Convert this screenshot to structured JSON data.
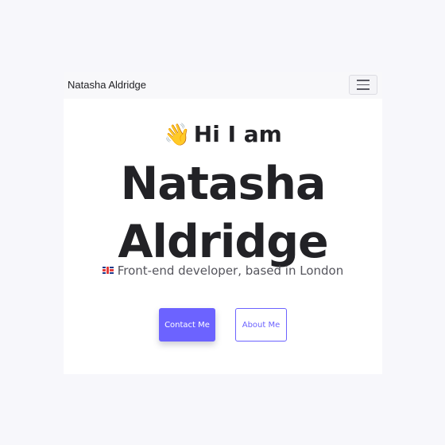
{
  "navbar": {
    "brand": "Natasha Aldridge",
    "toggler_icon": "hamburger-menu-icon"
  },
  "hero": {
    "wave_emoji": "👋",
    "greeting": "Hi I am",
    "name_line1": "Natasha",
    "name_line2": "Aldridge",
    "flag_icon": "uk-flag-icon",
    "tagline": "Front-end developer, based in London"
  },
  "buttons": {
    "contact_label": "Contact Me",
    "about_label": "About Me"
  },
  "colors": {
    "accent": "#6c63ff",
    "page_background": "#f7f7fb",
    "card_background": "#ffffff",
    "text": "#222226"
  }
}
